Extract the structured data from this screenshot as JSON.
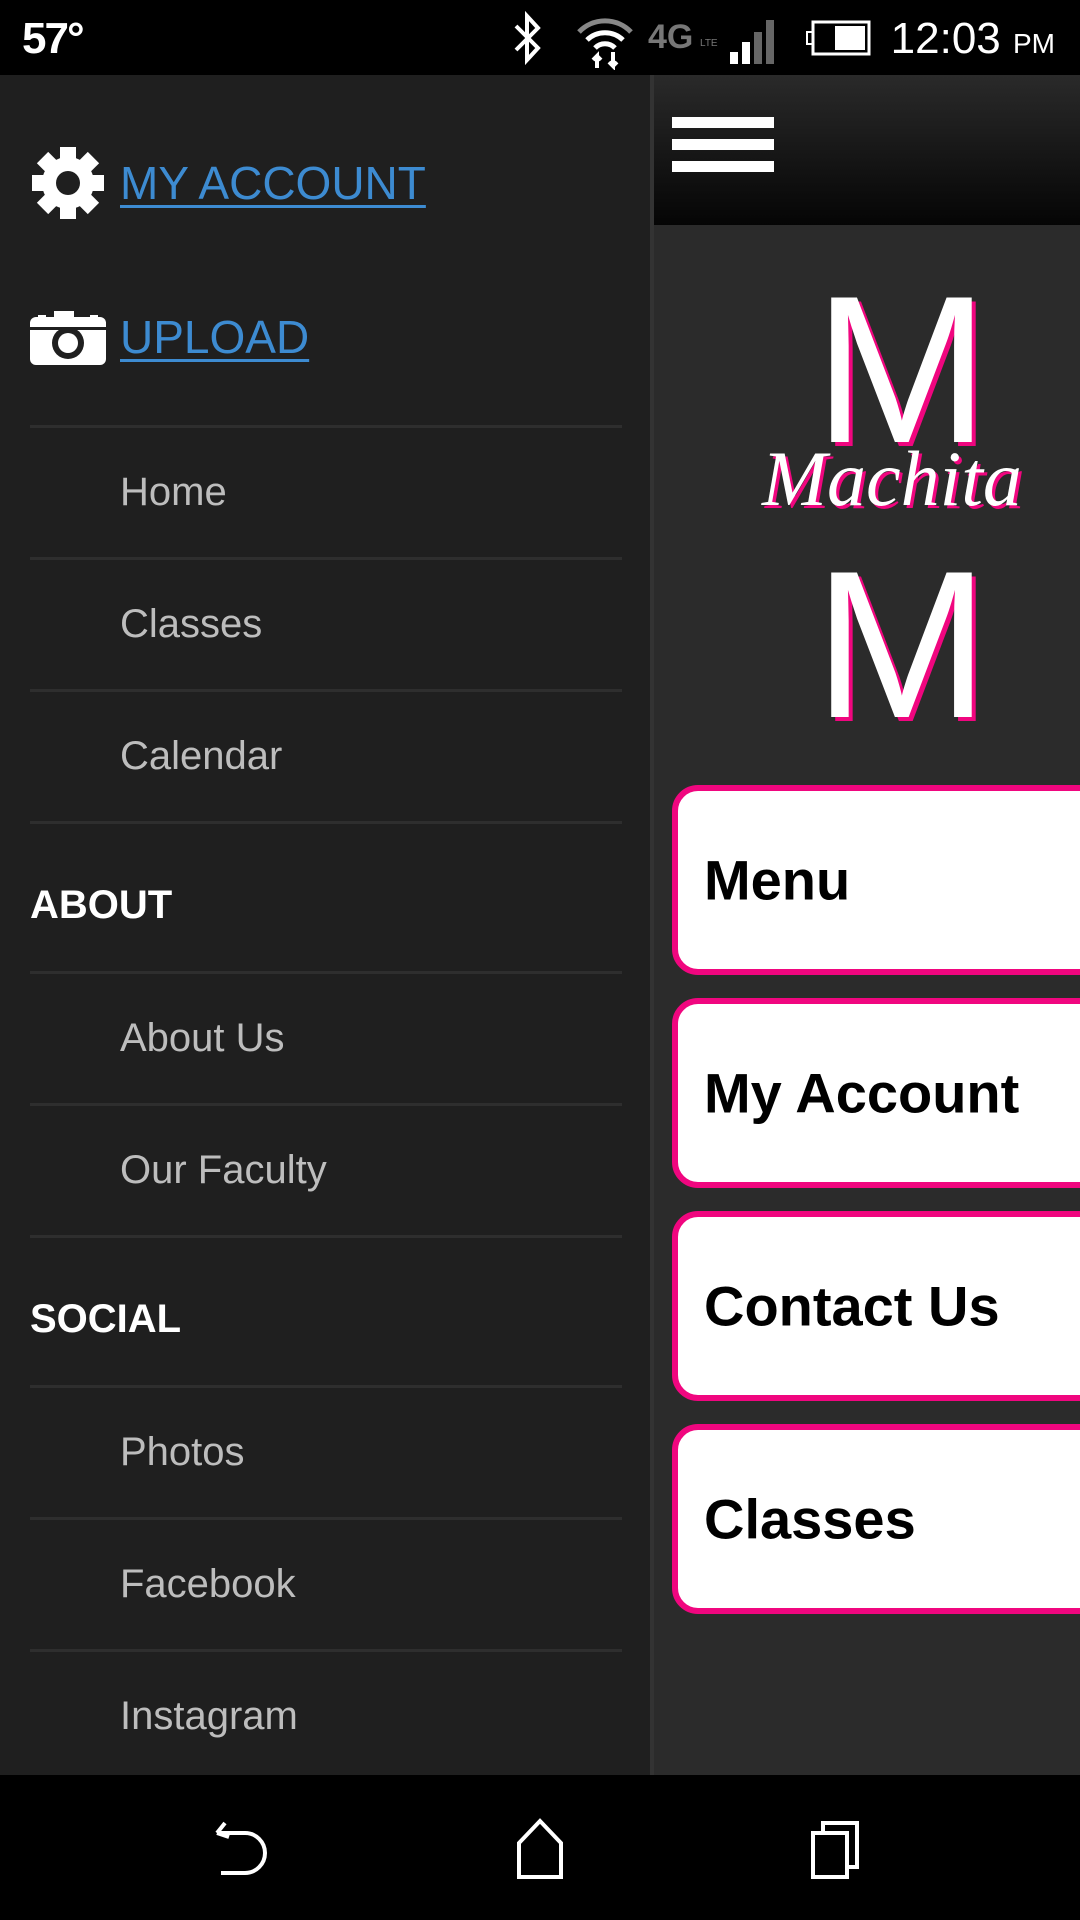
{
  "status_bar": {
    "temperature": "57°",
    "time": "12:03",
    "ampm": "PM",
    "icons": [
      "bluetooth-icon",
      "wifi-icon",
      "4g-lte-icon",
      "signal-icon",
      "battery-icon"
    ]
  },
  "drawer": {
    "top_links": [
      {
        "label": "MY ACCOUNT",
        "icon": "gear-icon"
      },
      {
        "label": "UPLOAD",
        "icon": "camera-icon"
      }
    ],
    "items_main": [
      "Home",
      "Classes",
      "Calendar"
    ],
    "section_about": "ABOUT",
    "items_about": [
      "About Us",
      "Our Faculty"
    ],
    "section_social": "SOCIAL",
    "items_social": [
      "Photos",
      "Facebook",
      "Instagram"
    ]
  },
  "main": {
    "logo_script": "Machita",
    "cards": [
      "Menu",
      "My Account",
      "Contact Us",
      "Classes"
    ]
  },
  "colors": {
    "accent_pink": "#f0067f",
    "link_blue": "#3d8bd1",
    "drawer_bg": "#1f1f1f"
  },
  "nav_bar": [
    "back-icon",
    "home-icon",
    "recents-icon"
  ]
}
